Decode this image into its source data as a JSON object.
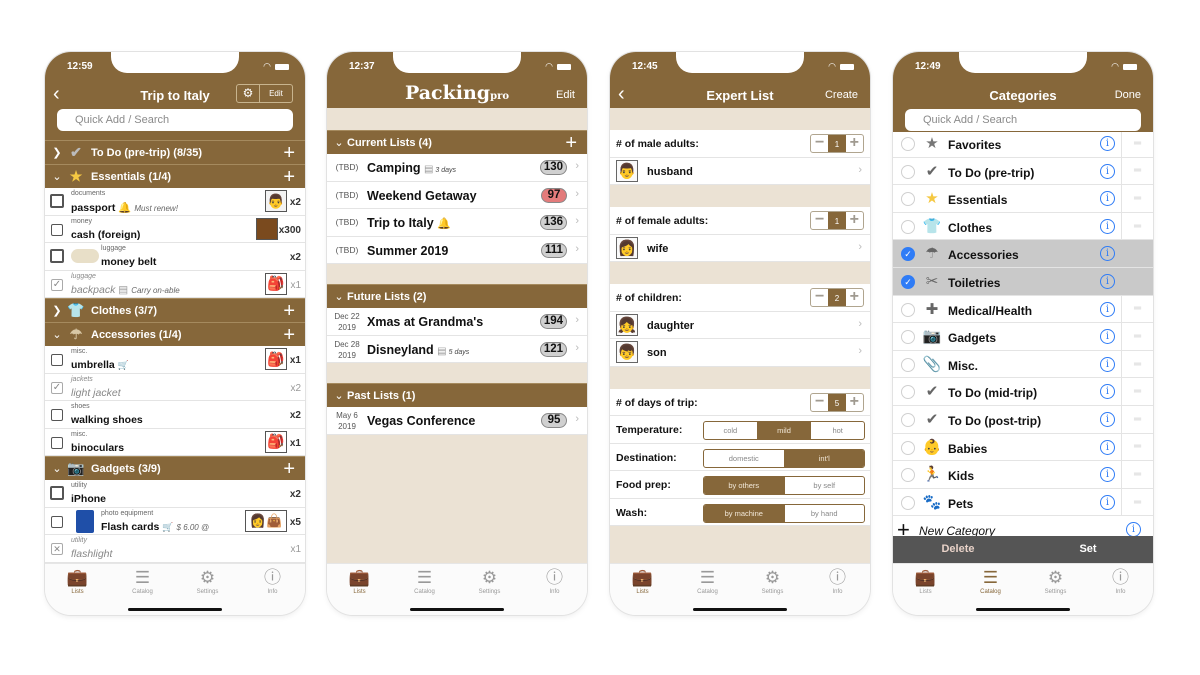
{
  "brand_color": "#86673a",
  "tabbar": {
    "tabs": [
      {
        "label": "Lists",
        "icon": "suitcase-icon"
      },
      {
        "label": "Catalog",
        "icon": "catalog-icon"
      },
      {
        "label": "Settings",
        "icon": "gear-icon"
      },
      {
        "label": "Info",
        "icon": "info-icon"
      }
    ]
  },
  "screen1": {
    "time": "12:59",
    "title": "Trip to Italy",
    "edit_label": "Edit",
    "search_placeholder": "Quick Add / Search",
    "sections": [
      {
        "label": "To Do (pre-trip) (8/35)",
        "expanded": false,
        "icon": "checkmark-icon"
      },
      {
        "label": "Essentials (1/4)",
        "expanded": true,
        "icon": "star-icon",
        "items": [
          {
            "category": "documents",
            "name": "passport",
            "note": "Must renew!",
            "note_icon": "bell-icon",
            "qty": "x2",
            "thumb": "man-emoji",
            "checked": false
          },
          {
            "category": "money",
            "name": "cash (foreign)",
            "qty": "x300",
            "thumb": "wallet",
            "checked": false
          },
          {
            "category": "luggage",
            "name": "money belt",
            "qty": "x2",
            "photo": "money-belt",
            "checked": false
          },
          {
            "category": "luggage",
            "name": "backpack",
            "note": "Carry on-able",
            "note_icon": "note-icon",
            "qty": "x1",
            "thumb": "backpack",
            "checked": true
          }
        ]
      },
      {
        "label": "Clothes (3/7)",
        "expanded": false,
        "icon": "shirt-icon"
      },
      {
        "label": "Accessories (1/4)",
        "expanded": true,
        "icon": "umbrella-icon",
        "items": [
          {
            "category": "misc.",
            "name": "umbrella",
            "note_icon": "cart-icon",
            "qty": "x1",
            "thumb": "backpack",
            "checked": false
          },
          {
            "category": "jackets",
            "name": "light jacket",
            "qty": "x2",
            "checked": true
          },
          {
            "category": "shoes",
            "name": "walking shoes",
            "qty": "x2",
            "checked": false
          },
          {
            "category": "misc.",
            "name": "binoculars",
            "qty": "x1",
            "thumb": "backpack",
            "checked": false
          }
        ]
      },
      {
        "label": "Gadgets (3/9)",
        "expanded": true,
        "icon": "camera-icon",
        "items": [
          {
            "category": "utility",
            "name": "iPhone",
            "qty": "x2",
            "checked": false
          },
          {
            "category": "photo equipment",
            "name": "Flash cards",
            "note": "$ 6.00 @",
            "note_icon": "cart-icon",
            "qty": "x5",
            "thumb": "woman-handbag",
            "checked": false
          },
          {
            "category": "utility",
            "name": "flashlight",
            "qty": "x1",
            "checked": "excluded"
          }
        ]
      }
    ],
    "active_tab": "Lists"
  },
  "screen2": {
    "time": "12:37",
    "logo": "Packing",
    "logo_suffix": "pro",
    "edit_label": "Edit",
    "groups": [
      {
        "label": "Current Lists (4)",
        "has_add": true,
        "lists": [
          {
            "date": "(TBD)",
            "name": "Camping",
            "note": "3 days",
            "count": "130",
            "alert": false
          },
          {
            "date": "(TBD)",
            "name": "Weekend Getaway",
            "count": "97",
            "alert": true
          },
          {
            "date": "(TBD)",
            "name": "Trip to Italy",
            "bell": true,
            "count": "136",
            "alert": false
          },
          {
            "date": "(TBD)",
            "name": "Summer 2019",
            "count": "111",
            "alert": false
          }
        ]
      },
      {
        "label": "Future Lists (2)",
        "has_add": false,
        "lists": [
          {
            "date_line1": "Dec 22",
            "date_line2": "2019",
            "name": "Xmas at Grandma's",
            "count": "194"
          },
          {
            "date_line1": "Dec 28",
            "date_line2": "2019",
            "name": "Disneyland",
            "note": "5 days",
            "count": "121"
          }
        ]
      },
      {
        "label": "Past Lists (1)",
        "has_add": false,
        "lists": [
          {
            "date_line1": "May 6",
            "date_line2": "2019",
            "name": "Vegas Conference",
            "count": "95"
          }
        ]
      }
    ],
    "active_tab": "Lists"
  },
  "screen3": {
    "time": "12:45",
    "title": "Expert List",
    "create_label": "Create",
    "male_label": "# of male adults:",
    "male_count": "1",
    "male_people": [
      "husband"
    ],
    "female_label": "# of female adults:",
    "female_count": "1",
    "female_people": [
      "wife"
    ],
    "children_label": "# of children:",
    "children_count": "2",
    "children_people": [
      "daughter",
      "son"
    ],
    "days_label": "# of days of trip:",
    "days_count": "5",
    "options": [
      {
        "label": "Temperature:",
        "choices": [
          "cold",
          "mild",
          "hot"
        ],
        "selected": "mild"
      },
      {
        "label": "Destination:",
        "choices": [
          "domestic",
          "int'l"
        ],
        "selected": "int'l"
      },
      {
        "label": "Food prep:",
        "choices": [
          "by others",
          "by self"
        ],
        "selected": "by others"
      },
      {
        "label": "Wash:",
        "choices": [
          "by machine",
          "by hand"
        ],
        "selected": "by machine"
      }
    ],
    "active_tab": "Lists"
  },
  "screen4": {
    "time": "12:49",
    "title": "Categories",
    "done_label": "Done",
    "search_placeholder": "Quick Add / Search",
    "categories": [
      {
        "name": "Favorites",
        "icon": "star-icon",
        "selected": false
      },
      {
        "name": "To Do (pre-trip)",
        "icon": "checkmark-icon",
        "selected": false
      },
      {
        "name": "Essentials",
        "icon": "gold-star-icon",
        "selected": false
      },
      {
        "name": "Clothes",
        "icon": "shirt-icon",
        "selected": false
      },
      {
        "name": "Accessories",
        "icon": "umbrella-icon",
        "selected": true
      },
      {
        "name": "Toiletries",
        "icon": "toiletries-icon",
        "selected": true
      },
      {
        "name": "Medical/Health",
        "icon": "medkit-icon",
        "selected": false
      },
      {
        "name": "Gadgets",
        "icon": "camera-icon",
        "selected": false
      },
      {
        "name": "Misc.",
        "icon": "paperclip-icon",
        "selected": false
      },
      {
        "name": "To Do (mid-trip)",
        "icon": "checkmark-icon",
        "selected": false
      },
      {
        "name": "To Do (post-trip)",
        "icon": "checkmark-icon",
        "selected": false
      },
      {
        "name": "Babies",
        "icon": "baby-icon",
        "selected": false
      },
      {
        "name": "Kids",
        "icon": "running-icon",
        "selected": false
      },
      {
        "name": "Pets",
        "icon": "paw-icon",
        "selected": false
      }
    ],
    "new_category_label": "New Category",
    "delete_label": "Delete",
    "set_label": "Set",
    "active_tab": "Catalog"
  }
}
